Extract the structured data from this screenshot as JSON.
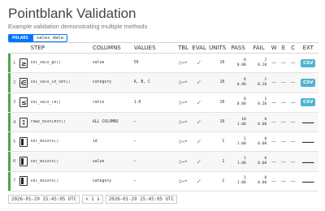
{
  "header": {
    "title": "Pointblank Validation",
    "subtitle": "Example validation demonstrating multiple methods",
    "tbl_type": "POLARS",
    "tbl_name": "sales_data"
  },
  "columns": {
    "step": "STEP",
    "columns": "COLUMNS",
    "values": "VALUES",
    "tbl": "TBL",
    "eval": "EVAL",
    "units": "UNITS",
    "pass": "PASS",
    "fail": "FAIL",
    "w": "W",
    "e": "E",
    "c": "C",
    "ext": "EXT"
  },
  "rows": [
    {
      "num": "1",
      "icon": "greater-than-icon",
      "glyph": "≥",
      "step": "col_vals_gt()",
      "columns": "value",
      "values": "50",
      "tbl": "○→•",
      "eval": "✓",
      "units": "10",
      "pass_n": "8",
      "pass_f": "0.80",
      "fail_n": "2",
      "fail_f": "0.20",
      "w": "—",
      "e": "—",
      "c": "—",
      "ext": "CSV"
    },
    {
      "num": "2",
      "icon": "in-set-icon",
      "glyph": "∈",
      "step": "col_vals_in_set()",
      "columns": "category",
      "values": "A, B, C",
      "tbl": "○→•",
      "eval": "✓",
      "units": "10",
      "pass_n": "8",
      "pass_f": "0.80",
      "fail_n": "2",
      "fail_f": "0.20",
      "w": "—",
      "e": "—",
      "c": "—",
      "ext": "CSV"
    },
    {
      "num": "3",
      "icon": "less-equal-icon",
      "glyph": "≤",
      "step": "col_vals_le()",
      "columns": "ratio",
      "values": "1.0",
      "tbl": "○→•",
      "eval": "✓",
      "units": "10",
      "pass_n": "8",
      "pass_f": "0.80",
      "fail_n": "2",
      "fail_f": "0.20",
      "w": "—",
      "e": "—",
      "c": "—",
      "ext": "CSV"
    },
    {
      "num": "4",
      "icon": "distinct-rows-icon",
      "glyph": "⁑",
      "step": "rows_distinct()",
      "columns": "ALL COLUMNS",
      "values": "—",
      "tbl": "○→•",
      "eval": "✓",
      "units": "10",
      "pass_n": "10",
      "pass_f": "1.00",
      "fail_n": "0",
      "fail_f": "0.00",
      "w": "—",
      "e": "—",
      "c": "—",
      "ext": "—"
    },
    {
      "num": "5",
      "icon": "column-exists-icon",
      "glyph": "",
      "step": "col_exists()",
      "columns": "id",
      "values": "—",
      "tbl": "○→•",
      "eval": "✓",
      "units": "1",
      "pass_n": "1",
      "pass_f": "1.00",
      "fail_n": "0",
      "fail_f": "0.00",
      "w": "—",
      "e": "—",
      "c": "—",
      "ext": "—"
    },
    {
      "num": "6",
      "icon": "column-exists-icon",
      "glyph": "",
      "step": "col_exists()",
      "columns": "value",
      "values": "—",
      "tbl": "○→•",
      "eval": "✓",
      "units": "1",
      "pass_n": "1",
      "pass_f": "1.00",
      "fail_n": "0",
      "fail_f": "0.00",
      "w": "—",
      "e": "—",
      "c": "—",
      "ext": "—"
    },
    {
      "num": "7",
      "icon": "column-exists-icon",
      "glyph": "",
      "step": "col_exists()",
      "columns": "category",
      "values": "—",
      "tbl": "○→•",
      "eval": "✓",
      "units": "1",
      "pass_n": "1",
      "pass_f": "1.00",
      "fail_n": "0",
      "fail_f": "0.00",
      "w": "—",
      "e": "—",
      "c": "—",
      "ext": "—"
    }
  ],
  "footer": {
    "start_time": "2026-01-29 15:45:05 UTC",
    "duration": "< 1 s",
    "end_time": "2026-01-29 15:45:05 UTC"
  },
  "colors": {
    "status_bar": "#4ca64c",
    "tag": "#0075ff",
    "csv_button": "#4fb3cf"
  }
}
